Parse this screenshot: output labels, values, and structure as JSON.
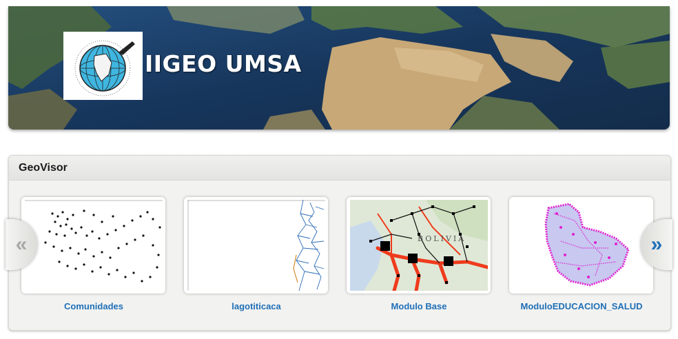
{
  "banner": {
    "title": "IIGEO UMSA",
    "logo_text": "Instituto de Investigaciones Geográficas IIGEO - UMSA"
  },
  "geovisor": {
    "title": "GeoVisor",
    "prev_label": "«",
    "next_label": "»",
    "items": [
      {
        "label": "Comunidades",
        "icon": "points-map-thumbnail"
      },
      {
        "label": "lagotiticaca",
        "icon": "rivers-map-thumbnail"
      },
      {
        "label": "Modulo Base",
        "icon": "road-network-map-thumbnail",
        "map_text": "BOLIVIA"
      },
      {
        "label": "ModuloEDUCACION_SALUD",
        "icon": "education-health-map-thumbnail"
      }
    ]
  },
  "colors": {
    "link": "#1f6fb7",
    "ocean": "#1c3d66",
    "desert": "#c8a877",
    "road": "#ef3b1c",
    "magenta": "#e020d0"
  }
}
